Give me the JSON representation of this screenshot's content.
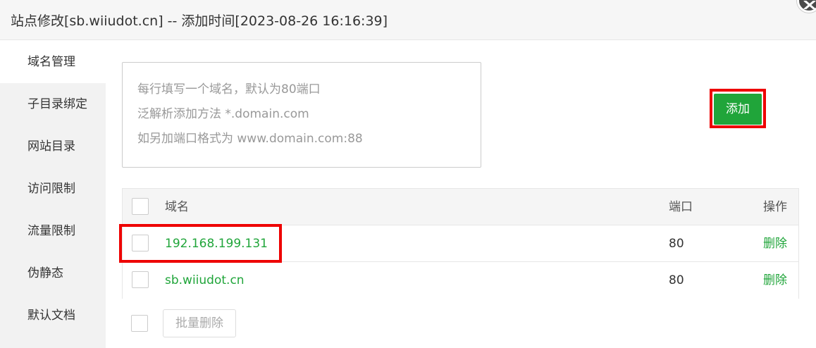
{
  "window": {
    "title": "站点修改[sb.wiiudot.cn] -- 添加时间[2023-08-26 16:16:39]"
  },
  "sidebar": {
    "items": [
      {
        "label": "域名管理",
        "active": true
      },
      {
        "label": "子目录绑定"
      },
      {
        "label": "网站目录"
      },
      {
        "label": "访问限制"
      },
      {
        "label": "流量限制"
      },
      {
        "label": "伪静态"
      },
      {
        "label": "默认文档"
      }
    ]
  },
  "domain_input": {
    "placeholder_lines": [
      "每行填写一个域名，默认为80端口",
      "泛解析添加方法 *.domain.com",
      "如另加端口格式为 www.domain.com:88"
    ]
  },
  "add_button": {
    "label": "添加"
  },
  "table": {
    "headers": {
      "domain": "域名",
      "port": "端口",
      "action": "操作"
    },
    "rows": [
      {
        "domain": "192.168.199.131",
        "port": "80",
        "action": "删除"
      },
      {
        "domain": "sb.wiiudot.cn",
        "port": "80",
        "action": "删除"
      }
    ]
  },
  "batch_delete": {
    "label": "批量删除"
  },
  "colors": {
    "accent": "#20a53a",
    "highlight": "#ee0000"
  }
}
